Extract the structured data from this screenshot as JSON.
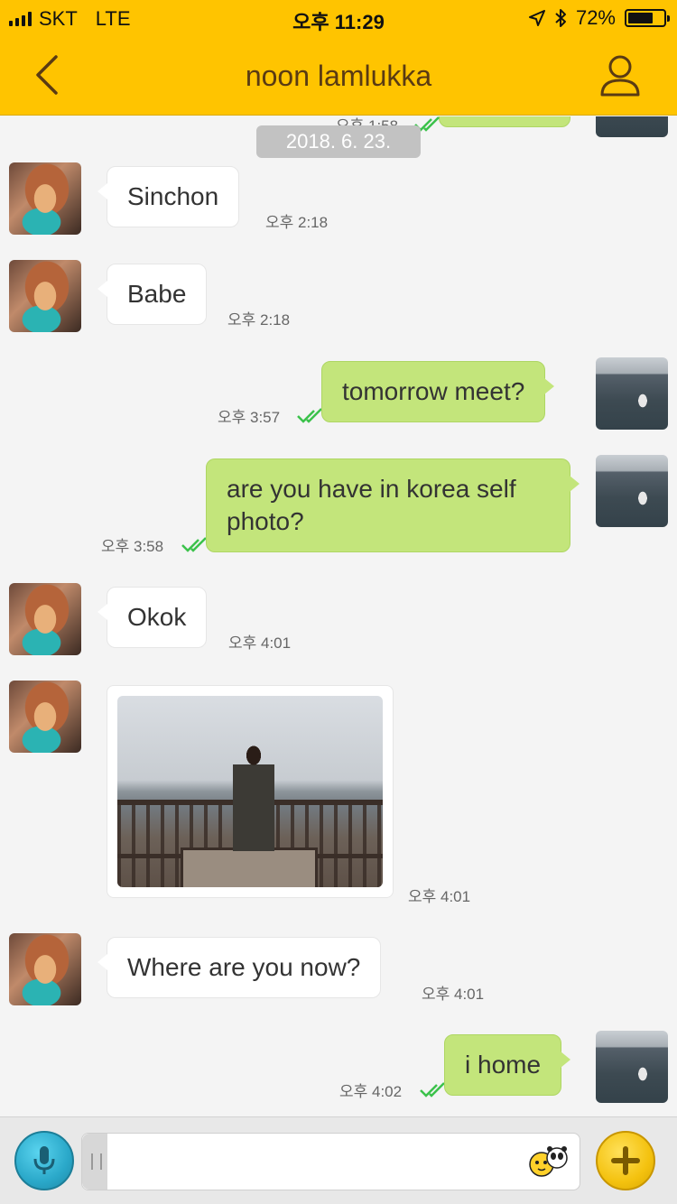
{
  "status": {
    "carrier": "SKT",
    "network": "LTE",
    "time": "오후 11:29",
    "battery": "72%",
    "battery_level": 0.72,
    "icons": [
      "signal-icon",
      "location-arrow-icon",
      "bluetooth-icon",
      "battery-icon"
    ]
  },
  "header": {
    "title": "noon lamlukka",
    "back_icon": "chevron-left-icon",
    "profile_icon": "person-icon"
  },
  "chat": {
    "date_separator": "2018. 6. 23.",
    "top_partial_time": "오후 1:58",
    "messages": [
      {
        "from": "them",
        "text": "Sinchon",
        "time": "오후 2:18"
      },
      {
        "from": "them",
        "text": "Babe",
        "time": "오후 2:18"
      },
      {
        "from": "me",
        "text": "tomorrow meet?",
        "time": "오후 3:57",
        "read": true
      },
      {
        "from": "me",
        "text_line1": "are you have in korea self",
        "text_line2": "photo?",
        "time": "오후 3:58",
        "read": true
      },
      {
        "from": "them",
        "text": "Okok",
        "time": "오후 4:01"
      },
      {
        "from": "them",
        "type": "photo",
        "time": "오후 4:01"
      },
      {
        "from": "them",
        "text": "Where are you now?",
        "time": "오후 4:01"
      },
      {
        "from": "me",
        "text": "i home",
        "time": "오후 4:02",
        "read": true
      }
    ]
  },
  "input": {
    "mic_icon": "microphone-icon",
    "emoticon_icon": "emoticon-icon",
    "plus_icon": "plus-icon",
    "value": ""
  },
  "colors": {
    "accent": "#ffc400",
    "title": "#5a3b13",
    "my_bubble": "#c3e57b",
    "their_bubble": "#ffffff",
    "read_check": "#3bc24b",
    "background": "#f4f4f4"
  }
}
